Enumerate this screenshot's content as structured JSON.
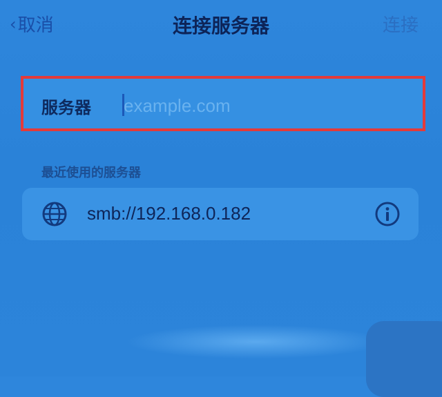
{
  "nav": {
    "cancel_label": "取消",
    "title": "连接服务器",
    "connect_label": "连接"
  },
  "server_field": {
    "label": "服务器",
    "placeholder": "example.com",
    "value": ""
  },
  "recent": {
    "header": "最近使用的服务器",
    "items": [
      {
        "address": "smb://192.168.0.182"
      }
    ]
  },
  "colors": {
    "highlight_border": "#e43a3a",
    "accent": "#1a4fa8"
  }
}
